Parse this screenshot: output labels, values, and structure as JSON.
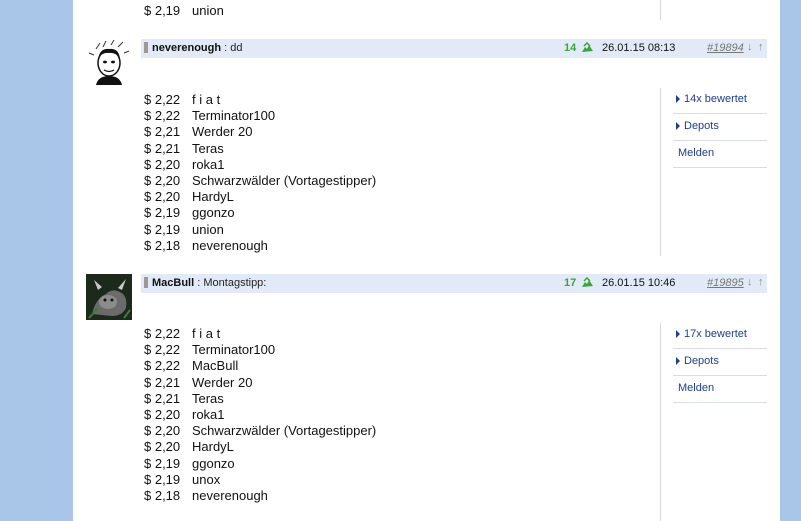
{
  "top_fragment": {
    "price": "$ 2,19",
    "name": "union"
  },
  "posts": [
    {
      "author": "neverenough",
      "subject": "dd",
      "score": "14",
      "date": "26.01.15 08:13",
      "post_number": "#19894",
      "ratings": "14x bewertet",
      "depots": "Depots",
      "report": "Melden",
      "entries": [
        {
          "price": "$ 2,22",
          "name": "f i a t"
        },
        {
          "price": "$ 2,22",
          "name": "Terminator100"
        },
        {
          "price": "$ 2,21",
          "name": "Werder 20"
        },
        {
          "price": "$ 2,21",
          "name": "Teras"
        },
        {
          "price": "$ 2,20",
          "name": "roka1"
        },
        {
          "price": "$ 2,20",
          "name": "Schwarzwälder (Vortagestipper)"
        },
        {
          "price": "$ 2,20",
          "name": "HardyL"
        },
        {
          "price": "$ 2,19",
          "name": "ggonzo"
        },
        {
          "price": "$ 2,19",
          "name": "union"
        },
        {
          "price": "$ 2,18",
          "name": "neverenough"
        }
      ]
    },
    {
      "author": "MacBull",
      "subject": "Montagstipp:",
      "score": "17",
      "date": "26.01.15 10:46",
      "post_number": "#19895",
      "ratings": "17x bewertet",
      "depots": "Depots",
      "report": "Melden",
      "entries": [
        {
          "price": "$ 2,22",
          "name": "f i a t"
        },
        {
          "price": "$ 2,22",
          "name": "Terminator100"
        },
        {
          "price": "$ 2,22",
          "name": "MacBull"
        },
        {
          "price": "$ 2,21",
          "name": "Werder 20"
        },
        {
          "price": "$ 2,21",
          "name": "Teras"
        },
        {
          "price": "$ 2,20",
          "name": "roka1"
        },
        {
          "price": "$ 2,20",
          "name": "Schwarzwälder (Vortagestipper)"
        },
        {
          "price": "$ 2,20",
          "name": "HardyL"
        },
        {
          "price": "$ 2,19",
          "name": "ggonzo"
        },
        {
          "price": "$ 2,19",
          "name": "unox"
        },
        {
          "price": "$ 2,18",
          "name": "neverenough"
        }
      ]
    }
  ],
  "header_separator": ":",
  "arrow_down": "↓",
  "arrow_up": "↑"
}
